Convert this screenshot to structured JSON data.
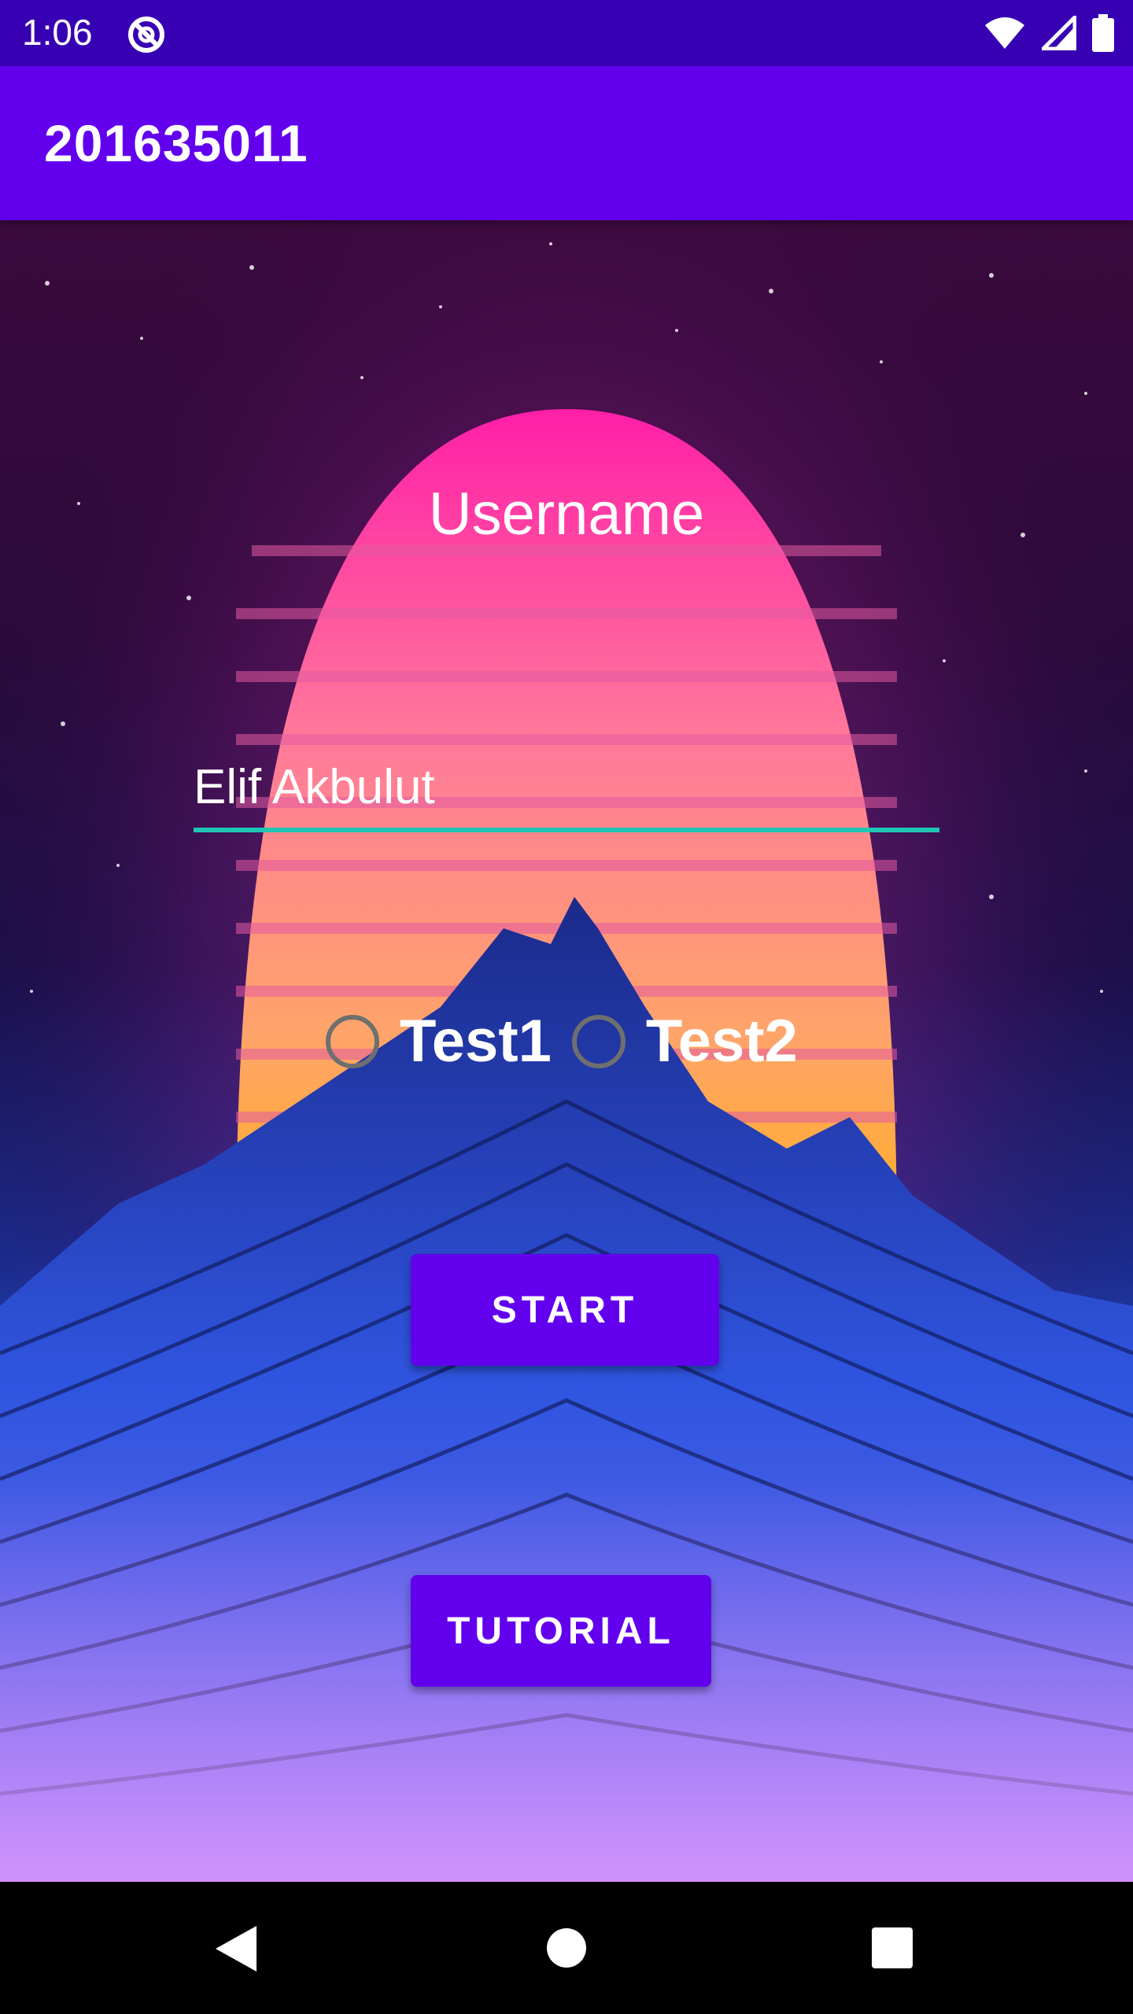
{
  "status_bar": {
    "time": "1:06",
    "icons": [
      "app-notification-icon",
      "wifi-icon",
      "signal-icon",
      "battery-icon"
    ]
  },
  "app_bar": {
    "title": "201635011"
  },
  "form": {
    "username_label": "Username",
    "username_value": "Elif Akbulut",
    "radio_options": [
      {
        "label": "Test1",
        "checked": false
      },
      {
        "label": "Test2",
        "checked": false
      }
    ],
    "start_label": "START",
    "tutorial_label": "TUTORIAL"
  },
  "nav_bar": {
    "icons": [
      "back-icon",
      "home-icon",
      "recents-icon"
    ]
  },
  "colors": {
    "status_bar": "#3700b3",
    "app_bar": "#6200ee",
    "accent": "#1fc6b4",
    "button": "#6200ee"
  }
}
